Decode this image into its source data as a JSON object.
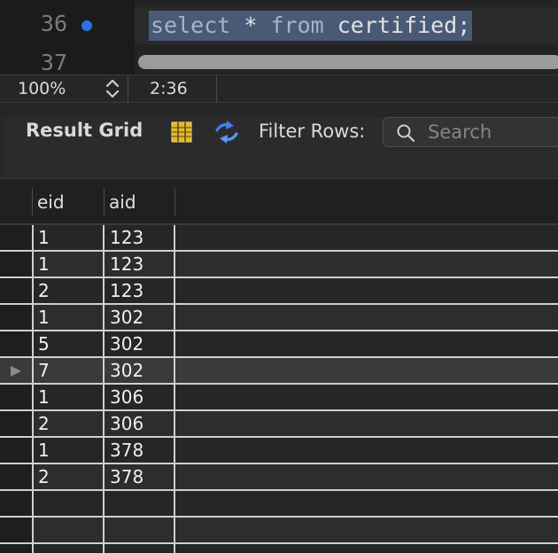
{
  "editor": {
    "line_numbers": [
      "36",
      "37"
    ],
    "code_tokens": [
      {
        "text": "select",
        "kind": "keyword"
      },
      {
        "text": " * ",
        "kind": "plain"
      },
      {
        "text": "from",
        "kind": "keyword"
      },
      {
        "text": " certified;",
        "kind": "plain"
      }
    ],
    "selection_color": "#495a77",
    "marker_color": "#2f6fe0"
  },
  "status_bar": {
    "zoom": "100%",
    "cursor_position": "2:36"
  },
  "toolbar": {
    "result_grid_label": "Result Grid",
    "filter_label": "Filter Rows:",
    "search_placeholder": "Search",
    "search_value": ""
  },
  "grid": {
    "columns": [
      "eid",
      "aid"
    ],
    "rows": [
      {
        "eid": "1",
        "aid": "123"
      },
      {
        "eid": "1",
        "aid": "123"
      },
      {
        "eid": "2",
        "aid": "123"
      },
      {
        "eid": "1",
        "aid": "302"
      },
      {
        "eid": "5",
        "aid": "302"
      },
      {
        "eid": "7",
        "aid": "302",
        "selected": true
      },
      {
        "eid": "1",
        "aid": "306"
      },
      {
        "eid": "2",
        "aid": "306"
      },
      {
        "eid": "1",
        "aid": "378"
      },
      {
        "eid": "2",
        "aid": "378"
      },
      {
        "eid": "",
        "aid": ""
      },
      {
        "eid": "",
        "aid": ""
      },
      {
        "eid": "",
        "aid": ""
      }
    ]
  },
  "icons": {
    "zoom_stepper": "up-down-chevron-icon",
    "grid": "result-grid-icon",
    "refresh": "refresh-icon",
    "search": "search-icon",
    "row_marker": "row-pointer-icon"
  }
}
